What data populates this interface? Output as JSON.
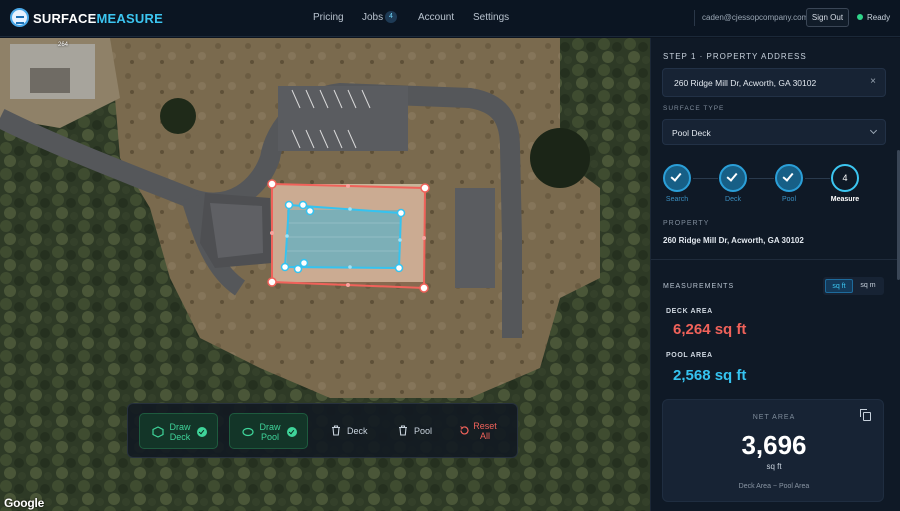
{
  "header": {
    "logo_a": "SURFACE",
    "logo_b": "MEASURE",
    "nav": [
      "Pricing",
      "Jobs",
      "Account",
      "Settings"
    ],
    "jobs_count": "4",
    "email": "caden@cjessopcompany.com",
    "signout": "Sign Out",
    "status": "Ready"
  },
  "map": {
    "google_label": "Google",
    "house_number": "264"
  },
  "toolbar": {
    "draw_deck": [
      "Draw",
      "Deck"
    ],
    "draw_pool": [
      "Draw",
      "Pool"
    ],
    "delete_deck": "Deck",
    "delete_pool": "Pool",
    "reset": [
      "Reset",
      "All"
    ]
  },
  "panel": {
    "step_title": "STEP 1 · PROPERTY ADDRESS",
    "address": "260 Ridge Mill Dr, Acworth, GA 30102",
    "address_clear": "×",
    "surface_type_label": "SURFACE TYPE",
    "surface_type": "Pool Deck",
    "steps": [
      {
        "label": "Search",
        "done": true
      },
      {
        "label": "Deck",
        "done": true
      },
      {
        "label": "Pool",
        "done": true
      },
      {
        "label": "Measure",
        "number": "4",
        "done": false
      }
    ],
    "property_label": "PROPERTY",
    "property_value": "260 Ridge Mill Dr, Acworth, GA 30102",
    "measurements_label": "MEASUREMENTS",
    "units": [
      "sq ft",
      "sq m"
    ],
    "deck_area_label": "DECK AREA",
    "deck_area_value": "6,264 sq ft",
    "pool_area_label": "POOL AREA",
    "pool_area_value": "2,568 sq ft",
    "net_area_label": "NET AREA",
    "net_area_value": "3,696",
    "net_area_unit": "sq ft",
    "net_area_formula": "Deck Area − Pool Area"
  },
  "colors": {
    "accent": "#3cc6f1",
    "deck": "#f0625a",
    "pool": "#35c3f0",
    "ready": "#2fd48a",
    "active_tool": "#3fd49a"
  }
}
